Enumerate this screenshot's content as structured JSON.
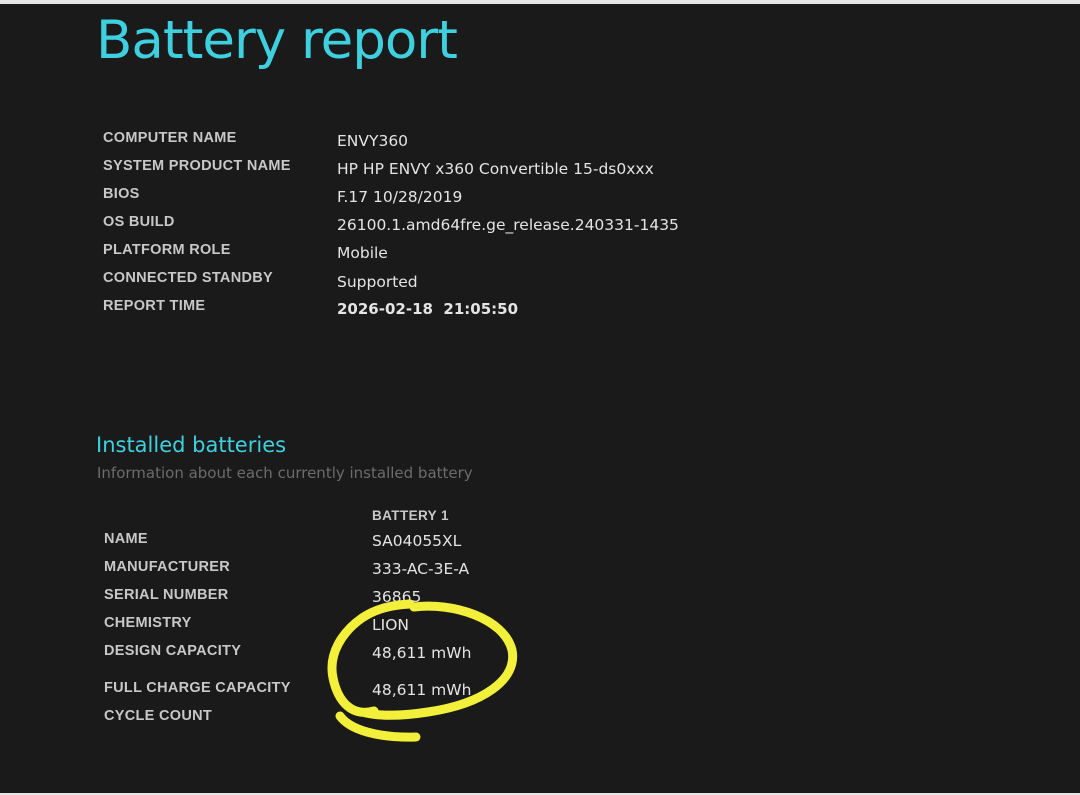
{
  "report": {
    "title": "Battery report"
  },
  "system_info": [
    {
      "label": "COMPUTER NAME",
      "value": "ENVY360"
    },
    {
      "label": "SYSTEM PRODUCT NAME",
      "value": "HP HP ENVY x360 Convertible 15-ds0xxx"
    },
    {
      "label": "BIOS",
      "value": "F.17 10/28/2019"
    },
    {
      "label": "OS BUILD",
      "value": "26100.1.amd64fre.ge_release.240331-1435"
    },
    {
      "label": "PLATFORM ROLE",
      "value": "Mobile"
    },
    {
      "label": "CONNECTED STANDBY",
      "value": "Supported"
    },
    {
      "label": "REPORT TIME",
      "value": "2026-02-18  21:05:50"
    }
  ],
  "installed_batteries": {
    "title": "Installed batteries",
    "subtitle": "Information about each currently installed battery",
    "column_header": "BATTERY 1",
    "rows": [
      {
        "label": "NAME",
        "value": "SA04055XL"
      },
      {
        "label": "MANUFACTURER",
        "value": "333-AC-3E-A"
      },
      {
        "label": "SERIAL NUMBER",
        "value": "36865"
      },
      {
        "label": "CHEMISTRY",
        "value": "LION"
      },
      {
        "label": "DESIGN CAPACITY",
        "value": "48,611 mWh"
      },
      {
        "label": "FULL CHARGE CAPACITY",
        "value": "48,611 mWh"
      },
      {
        "label": "CYCLE COUNT",
        "value": ""
      }
    ]
  },
  "annotation": {
    "color": "#f2f03a"
  }
}
